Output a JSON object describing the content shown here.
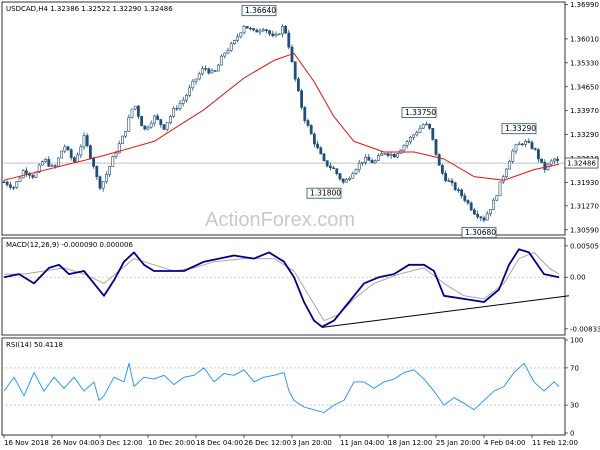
{
  "chart_data": [
    {
      "type": "candlestick",
      "header": "USDCAD,H4  1.32386 1.32522 1.32290 1.32486",
      "watermark": "ActionForex.com",
      "ylim": [
        1.305,
        1.37
      ],
      "yticks": [
        "1.36990",
        "1.36010",
        "1.35330",
        "1.34650",
        "1.33970",
        "1.33290",
        "1.32610",
        "1.31930",
        "1.31270",
        "1.30590"
      ],
      "ytick_values": [
        1.3699,
        1.3601,
        1.3533,
        1.3465,
        1.3397,
        1.3329,
        1.3261,
        1.3193,
        1.3127,
        1.3059
      ],
      "current_price": "1.32486",
      "current_value": 1.32486,
      "price_points": [
        [
          0,
          1.3195
        ],
        [
          10,
          1.318
        ],
        [
          20,
          1.323
        ],
        [
          30,
          1.321
        ],
        [
          40,
          1.326
        ],
        [
          50,
          1.323
        ],
        [
          60,
          1.33
        ],
        [
          70,
          1.325
        ],
        [
          80,
          1.332
        ],
        [
          90,
          1.324
        ],
        [
          95,
          1.318
        ],
        [
          100,
          1.32
        ],
        [
          110,
          1.327
        ],
        [
          120,
          1.333
        ],
        [
          130,
          1.342
        ],
        [
          140,
          1.334
        ],
        [
          150,
          1.338
        ],
        [
          160,
          1.335
        ],
        [
          170,
          1.34
        ],
        [
          180,
          1.343
        ],
        [
          190,
          1.348
        ],
        [
          200,
          1.352
        ],
        [
          210,
          1.35
        ],
        [
          220,
          1.356
        ],
        [
          230,
          1.359
        ],
        [
          240,
          1.364
        ],
        [
          250,
          1.362
        ],
        [
          260,
          1.3635
        ],
        [
          270,
          1.36
        ],
        [
          280,
          1.364
        ],
        [
          285,
          1.358
        ],
        [
          290,
          1.35
        ],
        [
          300,
          1.338
        ],
        [
          310,
          1.331
        ],
        [
          320,
          1.325
        ],
        [
          330,
          1.323
        ],
        [
          340,
          1.319
        ],
        [
          350,
          1.323
        ],
        [
          360,
          1.326
        ],
        [
          370,
          1.325
        ],
        [
          380,
          1.328
        ],
        [
          390,
          1.327
        ],
        [
          400,
          1.33
        ],
        [
          410,
          1.333
        ],
        [
          420,
          1.336
        ],
        [
          425,
          1.335
        ],
        [
          430,
          1.33
        ],
        [
          435,
          1.324
        ],
        [
          440,
          1.321
        ],
        [
          450,
          1.318
        ],
        [
          460,
          1.315
        ],
        [
          470,
          1.311
        ],
        [
          480,
          1.309
        ],
        [
          490,
          1.314
        ],
        [
          500,
          1.322
        ],
        [
          510,
          1.329
        ],
        [
          520,
          1.331
        ],
        [
          530,
          1.329
        ],
        [
          540,
          1.323
        ],
        [
          550,
          1.326
        ],
        [
          555,
          1.3249
        ]
      ],
      "ma_points": [
        [
          0,
          1.32
        ],
        [
          50,
          1.3235
        ],
        [
          100,
          1.327
        ],
        [
          150,
          1.331
        ],
        [
          200,
          1.34
        ],
        [
          240,
          1.349
        ],
        [
          270,
          1.354
        ],
        [
          290,
          1.356
        ],
        [
          310,
          1.348
        ],
        [
          330,
          1.338
        ],
        [
          350,
          1.331
        ],
        [
          380,
          1.328
        ],
        [
          410,
          1.328
        ],
        [
          440,
          1.326
        ],
        [
          470,
          1.321
        ],
        [
          500,
          1.32
        ],
        [
          530,
          1.323
        ],
        [
          555,
          1.3245
        ]
      ],
      "annotations": [
        {
          "text": "1.36640",
          "x": 255,
          "value": 1.3664
        },
        {
          "text": "1.33750",
          "x": 415,
          "value": 1.3375
        },
        {
          "text": "1.33290",
          "x": 515,
          "value": 1.3329
        },
        {
          "text": "1.31800",
          "x": 320,
          "value": 1.318
        },
        {
          "text": "1.30680",
          "x": 475,
          "value": 1.3068
        }
      ]
    },
    {
      "type": "line",
      "header": "MACD(12,26,9) -0.000090 0.000006",
      "ylim": [
        -0.009,
        0.006
      ],
      "yticks": [
        "0.00505",
        "0.00",
        "-0.008332"
      ],
      "ytick_values": [
        0.00505,
        0.0,
        -0.008332
      ],
      "series": [
        {
          "values": [
            [
              0,
              0.0
            ],
            [
              15,
              0.0005
            ],
            [
              30,
              -0.001
            ],
            [
              45,
              0.0015
            ],
            [
              55,
              0.002
            ],
            [
              65,
              0.0005
            ],
            [
              80,
              0.001
            ],
            [
              90,
              -0.001
            ],
            [
              100,
              -0.003
            ],
            [
              110,
              -0.0005
            ],
            [
              120,
              0.0025
            ],
            [
              130,
              0.004
            ],
            [
              140,
              0.002
            ],
            [
              150,
              0.001
            ],
            [
              165,
              0.001
            ],
            [
              180,
              0.001
            ],
            [
              200,
              0.0025
            ],
            [
              215,
              0.003
            ],
            [
              230,
              0.0035
            ],
            [
              250,
              0.003
            ],
            [
              265,
              0.004
            ],
            [
              280,
              0.0025
            ],
            [
              290,
              0.0
            ],
            [
              300,
              -0.004
            ],
            [
              310,
              -0.007
            ],
            [
              318,
              -0.008
            ],
            [
              330,
              -0.007
            ],
            [
              345,
              -0.004
            ],
            [
              360,
              -0.001
            ],
            [
              375,
              0.0
            ],
            [
              390,
              0.0005
            ],
            [
              405,
              0.002
            ],
            [
              420,
              0.002
            ],
            [
              430,
              0.001
            ],
            [
              440,
              -0.003
            ],
            [
              460,
              -0.0035
            ],
            [
              480,
              -0.004
            ],
            [
              495,
              -0.002
            ],
            [
              505,
              0.002
            ],
            [
              515,
              0.0045
            ],
            [
              525,
              0.004
            ],
            [
              540,
              0.0005
            ],
            [
              555,
              0.0
            ]
          ]
        },
        {
          "values": [
            [
              0,
              0.0005
            ],
            [
              20,
              0.0005
            ],
            [
              40,
              0.001
            ],
            [
              60,
              0.0015
            ],
            [
              80,
              0.0005
            ],
            [
              100,
              -0.001
            ],
            [
              115,
              0.001
            ],
            [
              130,
              0.003
            ],
            [
              150,
              0.002
            ],
            [
              170,
              0.001
            ],
            [
              190,
              0.0015
            ],
            [
              210,
              0.0025
            ],
            [
              240,
              0.003
            ],
            [
              270,
              0.003
            ],
            [
              290,
              0.001
            ],
            [
              305,
              -0.003
            ],
            [
              320,
              -0.007
            ],
            [
              335,
              -0.006
            ],
            [
              350,
              -0.0035
            ],
            [
              370,
              -0.001
            ],
            [
              395,
              0.0005
            ],
            [
              420,
              0.0015
            ],
            [
              440,
              -0.001
            ],
            [
              460,
              -0.003
            ],
            [
              480,
              -0.0035
            ],
            [
              500,
              -0.001
            ],
            [
              515,
              0.003
            ],
            [
              530,
              0.004
            ],
            [
              545,
              0.0015
            ],
            [
              555,
              0.0005
            ]
          ]
        }
      ],
      "trendline": [
        [
          318,
          -0.0081
        ],
        [
          565,
          -0.003
        ]
      ]
    },
    {
      "type": "line",
      "header": "RSI(14) 50.4118",
      "ylim": [
        0,
        100
      ],
      "yticks": [
        "100",
        "70",
        "30",
        "0"
      ],
      "ytick_values": [
        100,
        70,
        30,
        0
      ],
      "series": [
        {
          "values": [
            [
              0,
              45
            ],
            [
              10,
              60
            ],
            [
              20,
              40
            ],
            [
              30,
              65
            ],
            [
              40,
              45
            ],
            [
              50,
              60
            ],
            [
              60,
              48
            ],
            [
              70,
              60
            ],
            [
              80,
              45
            ],
            [
              90,
              55
            ],
            [
              95,
              35
            ],
            [
              100,
              40
            ],
            [
              110,
              60
            ],
            [
              120,
              55
            ],
            [
              125,
              75
            ],
            [
              130,
              50
            ],
            [
              140,
              60
            ],
            [
              150,
              58
            ],
            [
              160,
              62
            ],
            [
              170,
              52
            ],
            [
              180,
              60
            ],
            [
              190,
              62
            ],
            [
              200,
              70
            ],
            [
              210,
              55
            ],
            [
              220,
              64
            ],
            [
              230,
              62
            ],
            [
              240,
              68
            ],
            [
              250,
              55
            ],
            [
              260,
              60
            ],
            [
              270,
              62
            ],
            [
              280,
              65
            ],
            [
              285,
              45
            ],
            [
              290,
              35
            ],
            [
              300,
              28
            ],
            [
              310,
              25
            ],
            [
              320,
              22
            ],
            [
              330,
              30
            ],
            [
              340,
              35
            ],
            [
              350,
              55
            ],
            [
              360,
              55
            ],
            [
              370,
              48
            ],
            [
              380,
              55
            ],
            [
              390,
              58
            ],
            [
              400,
              65
            ],
            [
              410,
              68
            ],
            [
              420,
              58
            ],
            [
              430,
              45
            ],
            [
              440,
              30
            ],
            [
              450,
              38
            ],
            [
              460,
              32
            ],
            [
              470,
              25
            ],
            [
              480,
              35
            ],
            [
              490,
              45
            ],
            [
              500,
              50
            ],
            [
              510,
              65
            ],
            [
              520,
              75
            ],
            [
              530,
              55
            ],
            [
              540,
              45
            ],
            [
              550,
              55
            ],
            [
              555,
              50
            ]
          ]
        }
      ]
    }
  ],
  "xaxis": {
    "labels": [
      "16 Nov 2018",
      "26 Nov 04:00",
      "3 Dec 12:00",
      "10 Dec 20:00",
      "18 Dec 04:00",
      "26 Dec 12:00",
      "3 Jan 20:00",
      "11 Jan 04:00",
      "18 Jan 12:00",
      "25 Jan 20:00",
      "4 Feb 04:00",
      "11 Feb 12:00"
    ],
    "label_positions": [
      0,
      48,
      96,
      144,
      192,
      240,
      288,
      336,
      384,
      432,
      480,
      528
    ]
  },
  "colors": {
    "candle": "#1f4e79",
    "ma": "#e8120c",
    "macd": "#00008b",
    "signal": "#a9a9a9",
    "rsi": "#1e90ff",
    "trendline": "#000000",
    "grid_dash": "#b0b0b0",
    "frame": "#000000",
    "watermark": "#c8c8c8"
  }
}
